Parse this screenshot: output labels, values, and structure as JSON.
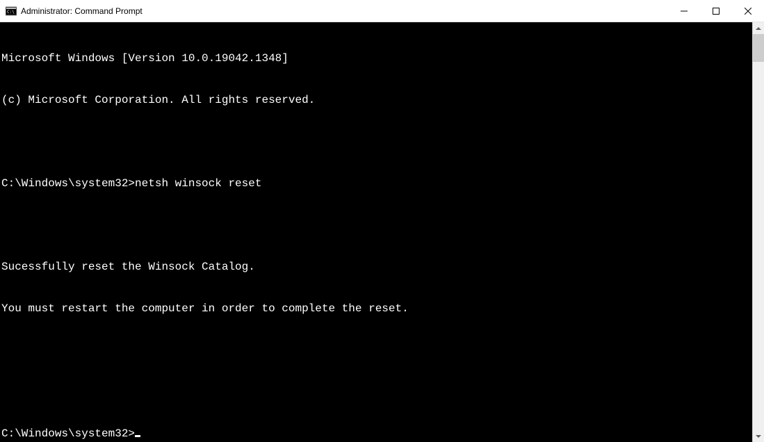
{
  "window": {
    "title": "Administrator: Command Prompt"
  },
  "terminal": {
    "lines": [
      "Microsoft Windows [Version 10.0.19042.1348]",
      "(c) Microsoft Corporation. All rights reserved.",
      "",
      "C:\\Windows\\system32>netsh winsock reset",
      "",
      "Sucessfully reset the Winsock Catalog.",
      "You must restart the computer in order to complete the reset.",
      "",
      ""
    ],
    "prompt": "C:\\Windows\\system32>"
  }
}
